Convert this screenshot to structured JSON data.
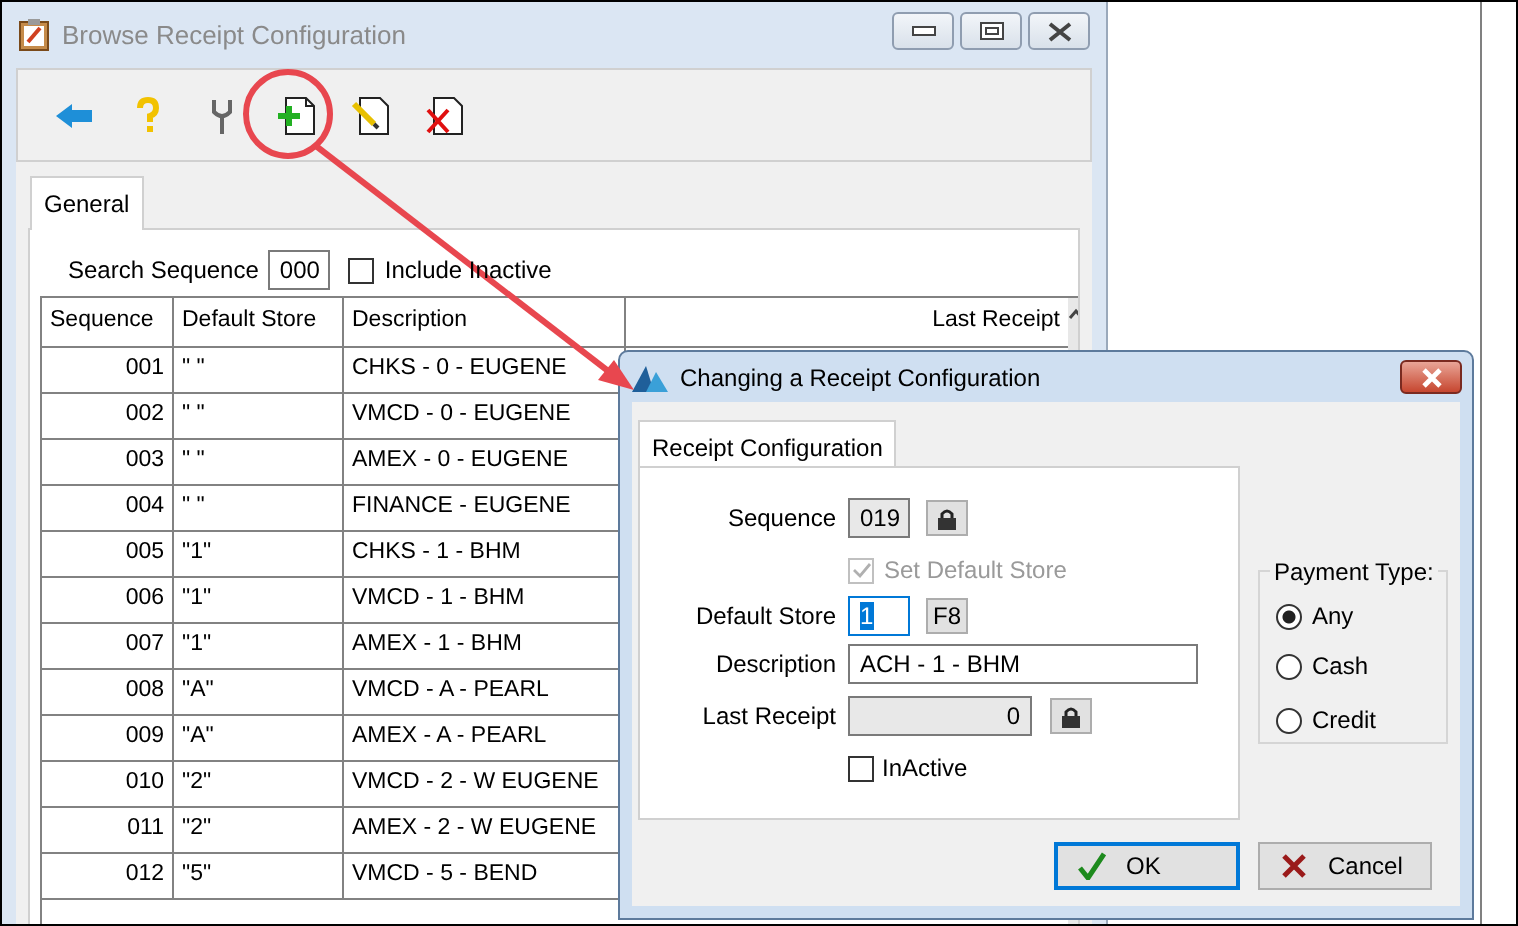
{
  "browse_window": {
    "title": "Browse Receipt Configuration",
    "tabs": [
      {
        "label": "General",
        "selected": true
      }
    ],
    "search": {
      "label": "Search Sequence",
      "value": "000"
    },
    "include_inactive": {
      "label": "Include Inactive",
      "checked": false
    },
    "table": {
      "columns": [
        "Sequence",
        "Default Store",
        "Description",
        "Last Receipt"
      ],
      "rows": [
        [
          "001",
          "\" \"",
          "CHKS - 0 - EUGENE"
        ],
        [
          "002",
          "\" \"",
          "VMCD - 0 - EUGENE"
        ],
        [
          "003",
          "\" \"",
          "AMEX - 0 - EUGENE"
        ],
        [
          "004",
          "\" \"",
          "FINANCE - EUGENE"
        ],
        [
          "005",
          "\"1\"",
          "CHKS - 1 - BHM"
        ],
        [
          "006",
          "\"1\"",
          "VMCD - 1 - BHM"
        ],
        [
          "007",
          "\"1\"",
          "AMEX - 1 - BHM"
        ],
        [
          "008",
          "\"A\"",
          "VMCD - A - PEARL"
        ],
        [
          "009",
          "\"A\"",
          "AMEX - A - PEARL"
        ],
        [
          "010",
          "\"2\"",
          "VMCD - 2 - W EUGENE"
        ],
        [
          "011",
          "\"2\"",
          "AMEX - 2 - W EUGENE"
        ],
        [
          "012",
          "\"5\"",
          "VMCD - 5 - BEND"
        ]
      ]
    }
  },
  "dialog": {
    "title": "Changing a Receipt Configuration",
    "tabs": [
      {
        "label": "Receipt Configuration",
        "selected": true
      }
    ],
    "sequence": {
      "label": "Sequence",
      "value": "019"
    },
    "set_default_store": {
      "label": "Set Default Store",
      "checked": true,
      "disabled": true
    },
    "default_store": {
      "label": "Default Store",
      "value": "1",
      "lookup_key": "F8"
    },
    "description": {
      "label": "Description",
      "value": "ACH - 1 - BHM"
    },
    "last_receipt": {
      "label": "Last Receipt",
      "value": "0"
    },
    "inactive": {
      "label": "InActive",
      "checked": false
    },
    "payment_type": {
      "label": "Payment Type:",
      "options": [
        {
          "label": "Any",
          "selected": true
        },
        {
          "label": "Cash",
          "selected": false
        },
        {
          "label": "Credit",
          "selected": false
        }
      ]
    },
    "buttons": [
      {
        "label": "OK",
        "kind": "ok",
        "default": true
      },
      {
        "label": "Cancel",
        "kind": "cancel",
        "default": false
      }
    ]
  }
}
